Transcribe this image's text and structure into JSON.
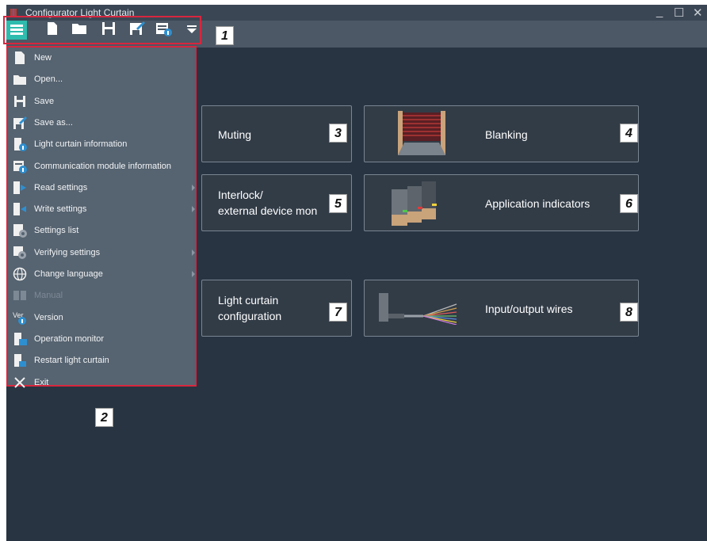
{
  "window": {
    "title": "Configurator Light Curtain",
    "controls": [
      "minimize",
      "maximize",
      "close"
    ]
  },
  "toolbar": {
    "icons": [
      "menu-icon",
      "new-file-icon",
      "open-folder-icon",
      "save-icon",
      "save-as-icon",
      "light-curtain-info-icon",
      "dropdown-icon"
    ],
    "callout": "1"
  },
  "menu": {
    "callout": "2",
    "items": [
      {
        "label": "New",
        "icon": "new-file-icon",
        "enabled": true,
        "submenu": false
      },
      {
        "label": "Open...",
        "icon": "open-folder-icon",
        "enabled": true,
        "submenu": false
      },
      {
        "label": "Save",
        "icon": "save-icon",
        "enabled": true,
        "submenu": false
      },
      {
        "label": "Save as...",
        "icon": "save-as-icon",
        "enabled": true,
        "submenu": false
      },
      {
        "label": "Light curtain information",
        "icon": "light-curtain-info-icon",
        "enabled": true,
        "submenu": false
      },
      {
        "label": "Communication module information",
        "icon": "communication-module-info-icon",
        "enabled": true,
        "submenu": false
      },
      {
        "label": "Read settings",
        "icon": "read-settings-icon",
        "enabled": true,
        "submenu": true
      },
      {
        "label": "Write settings",
        "icon": "write-settings-icon",
        "enabled": true,
        "submenu": true
      },
      {
        "label": "Settings list",
        "icon": "settings-list-icon",
        "enabled": true,
        "submenu": false
      },
      {
        "label": "Verifying settings",
        "icon": "verifying-settings-icon",
        "enabled": true,
        "submenu": true
      },
      {
        "label": "Change language",
        "icon": "globe-icon",
        "enabled": true,
        "submenu": true
      },
      {
        "label": "Manual",
        "icon": "manual-icon",
        "enabled": false,
        "submenu": false
      },
      {
        "label": "Version",
        "icon": "version-icon",
        "enabled": true,
        "submenu": false
      },
      {
        "label": "Operation monitor",
        "icon": "operation-monitor-icon",
        "enabled": true,
        "submenu": false
      },
      {
        "label": "Restart light curtain",
        "icon": "restart-icon",
        "enabled": true,
        "submenu": false
      },
      {
        "label": "Exit",
        "icon": "exit-icon",
        "enabled": true,
        "submenu": false
      }
    ]
  },
  "tiles": {
    "muting": {
      "label": "Muting",
      "callout": "3"
    },
    "blanking": {
      "label": "Blanking",
      "callout": "4"
    },
    "interlock": {
      "line1": "Interlock/",
      "line2": "external device mon",
      "callout": "5"
    },
    "application_indicators": {
      "label": "Application indicators",
      "callout": "6"
    },
    "light_curtain_configuration": {
      "line1": "Light curtain",
      "line2": "configuration",
      "callout": "7"
    },
    "input_output_wires": {
      "label": "Input/output wires",
      "callout": "8"
    }
  },
  "colors": {
    "background": "#283442",
    "toolbar": "#4c5865",
    "menu": "#566370",
    "accent": "#2ebcae",
    "highlight_border": "#d8263e"
  }
}
